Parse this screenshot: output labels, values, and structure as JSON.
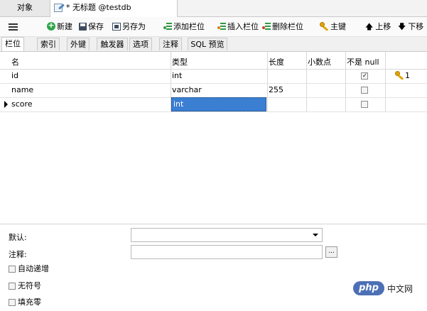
{
  "tabs": {
    "objects": "对象",
    "document": "* 无标题 @testdb (localhost)..."
  },
  "toolbar": {
    "new": "新建",
    "save": "保存",
    "save_as": "另存为",
    "add_field": "添加栏位",
    "insert_field": "插入栏位",
    "delete_field": "删除栏位",
    "primary_key": "主键",
    "move_up": "上移",
    "move_down": "下移"
  },
  "subtabs": [
    "栏位",
    "索引",
    "外键",
    "触发器",
    "选项",
    "注释",
    "SQL 预览"
  ],
  "table": {
    "headers": {
      "name": "名",
      "type": "类型",
      "length": "长度",
      "decimals": "小数点",
      "not_null": "不是 null"
    },
    "rows": [
      {
        "name": "id",
        "type": "int",
        "length": "",
        "decimals": "",
        "not_null": true,
        "key": "1"
      },
      {
        "name": "name",
        "type": "varchar",
        "length": "255",
        "decimals": "",
        "not_null": false,
        "key": ""
      },
      {
        "name": "score",
        "type": "int",
        "length": "",
        "decimals": "",
        "not_null": false,
        "key": ""
      }
    ]
  },
  "properties": {
    "default_label": "默认:",
    "default_value": "",
    "comment_label": "注释:",
    "comment_value": "",
    "ellipsis": "...",
    "auto_increment": "自动递增",
    "unsigned": "无符号",
    "zerofill": "填充零"
  },
  "watermark": {
    "logo": "php",
    "site": "中文网"
  },
  "colors": {
    "selection": "#3b7fd3",
    "key_icon": "#e2a400",
    "new_icon": "#2fa54a",
    "watermark": "#4c70b6"
  },
  "icons": [
    "hamburger-icon",
    "document-edit-icon",
    "new-icon",
    "save-icon",
    "save-as-icon",
    "add-field-icon",
    "insert-field-icon",
    "delete-field-icon",
    "key-icon",
    "arrow-up-icon",
    "arrow-down-icon",
    "row-marker-icon",
    "dropdown-caret-icon"
  ]
}
